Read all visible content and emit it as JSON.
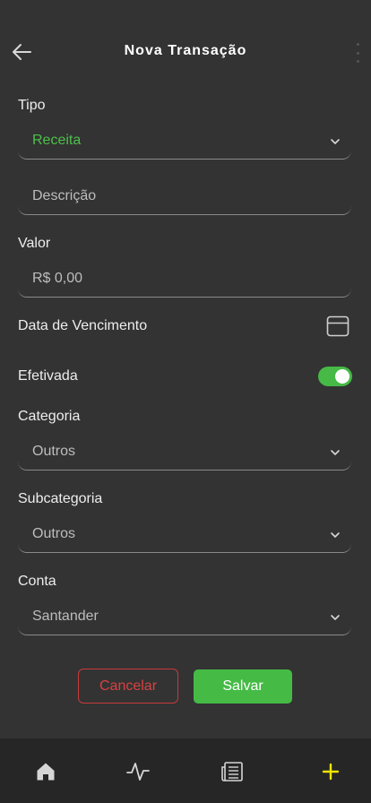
{
  "header": {
    "title": "Nova Transação"
  },
  "form": {
    "tipo": {
      "label": "Tipo",
      "value": "Receita"
    },
    "descricao": {
      "placeholder": "Descrição"
    },
    "valor": {
      "label": "Valor",
      "placeholder": "R$ 0,00"
    },
    "vencimento": {
      "label": "Data de Vencimento"
    },
    "efetivada": {
      "label": "Efetivada",
      "on": true
    },
    "categoria": {
      "label": "Categoria",
      "value": "Outros"
    },
    "subcategoria": {
      "label": "Subcategoria",
      "value": "Outros"
    },
    "conta": {
      "label": "Conta",
      "value": "Santander"
    }
  },
  "actions": {
    "cancel_label": "Cancelar",
    "save_label": "Salvar"
  },
  "nav": {
    "items": [
      "home-icon",
      "activity-icon",
      "newspaper-icon",
      "plus-icon"
    ]
  },
  "colors": {
    "background": "#333333",
    "accent_green": "#45bb45",
    "danger": "#d94141",
    "plus_yellow": "#f2e600"
  }
}
